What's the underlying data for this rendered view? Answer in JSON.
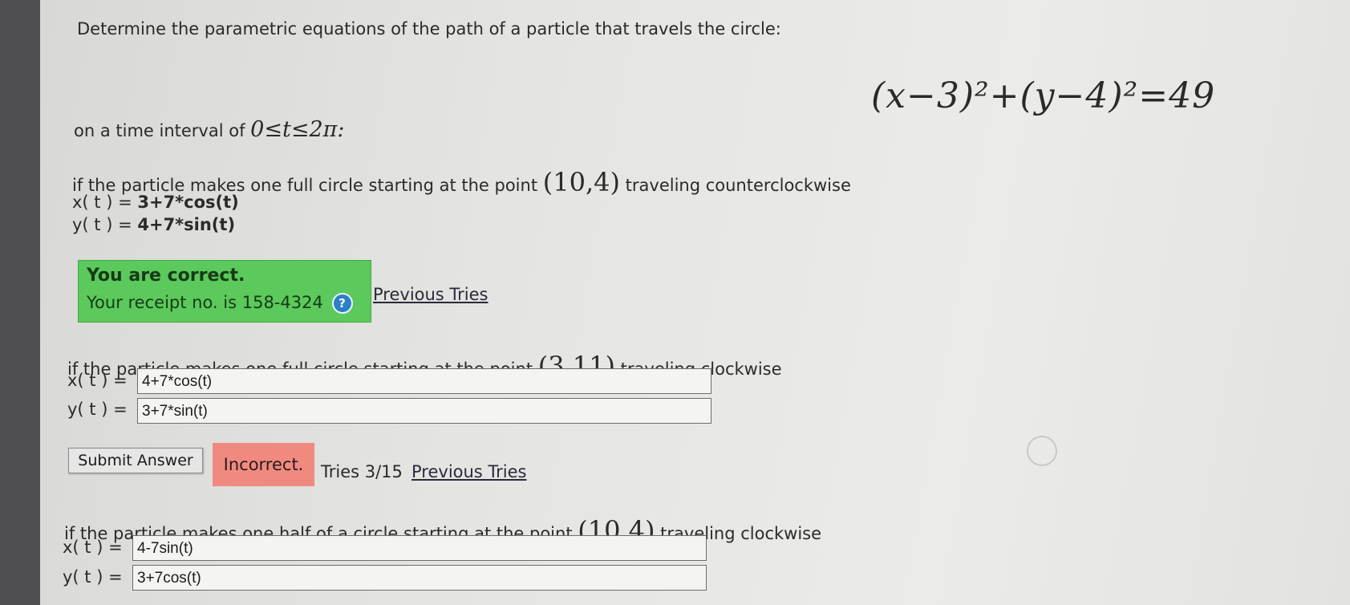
{
  "intro": "Determine the parametric equations of the path of a particle that travels the circle:",
  "circle_equation": "(x−3)²+(y−4)²=49",
  "interval_label": "on a time interval of",
  "interval_math": "0≤t≤2π:",
  "part1": {
    "prompt_before": "if the particle makes one full circle starting at the point",
    "point": "(10,4)",
    "prompt_after": "traveling counterclockwise",
    "x_label": "x( t ) =",
    "x_answer": "3+7*cos(t)",
    "y_label": "y( t ) =",
    "y_answer": "4+7*sin(t)",
    "feedback_title": "You are correct.",
    "receipt": "Your receipt no. is 158-4324",
    "help_icon": "?",
    "previous_tries": "Previous Tries"
  },
  "part2": {
    "prompt_before": "if the particle makes one full circle starting at the point",
    "point": "(3,11)",
    "prompt_after": "traveling clockwise",
    "x_label": "x( t ) =",
    "x_value": "4+7*cos(t)",
    "y_label": "y( t ) =",
    "y_value": "3+7*sin(t)",
    "submit_label": "Submit Answer",
    "status": "Incorrect.",
    "tries": "Tries 3/15",
    "previous_tries": "Previous Tries"
  },
  "part3": {
    "prompt_before": "if the particle makes one half of a circle starting at the point",
    "point": "(10,4)",
    "prompt_after": "traveling clockwise",
    "x_label": "x( t ) =",
    "x_value": "4-7sin(t)",
    "y_label": "y( t ) =",
    "y_value": "3+7cos(t)"
  },
  "colors": {
    "correct_bg": "#5bc95b",
    "incorrect_bg": "#f08a80",
    "help_icon_bg": "#2d7fc6"
  }
}
